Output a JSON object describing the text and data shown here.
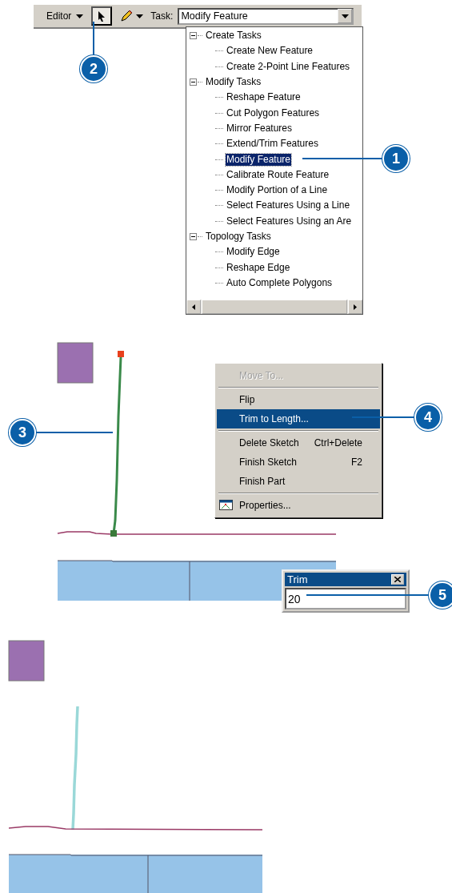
{
  "toolbar": {
    "editor_menu": "Editor",
    "tools": [
      {
        "kind": "pointer",
        "selected": true
      },
      {
        "kind": "pencil",
        "selected": false
      }
    ],
    "task_label": "Task:",
    "task_value": "Modify Feature"
  },
  "task_list": [
    {
      "label": "Create Tasks",
      "expanded": true,
      "children": [
        {
          "label": "Create New Feature",
          "selected": false
        },
        {
          "label": "Create 2-Point Line Features",
          "selected": false
        }
      ]
    },
    {
      "label": "Modify Tasks",
      "expanded": true,
      "children": [
        {
          "label": "Reshape Feature",
          "selected": false
        },
        {
          "label": "Cut Polygon Features",
          "selected": false
        },
        {
          "label": "Mirror Features",
          "selected": false
        },
        {
          "label": "Extend/Trim Features",
          "selected": false
        },
        {
          "label": "Modify Feature",
          "selected": true
        },
        {
          "label": "Calibrate Route Feature",
          "selected": false
        },
        {
          "label": "Modify Portion of a Line",
          "selected": false
        },
        {
          "label": "Select Features Using a Line",
          "selected": false
        },
        {
          "label": "Select Features Using an Are",
          "selected": false
        }
      ]
    },
    {
      "label": "Topology Tasks",
      "expanded": true,
      "children": [
        {
          "label": "Modify Edge",
          "selected": false
        },
        {
          "label": "Reshape Edge",
          "selected": false
        },
        {
          "label": "Auto Complete Polygons",
          "selected": false
        }
      ]
    }
  ],
  "context_menu": [
    {
      "kind": "item",
      "label": "Move To...",
      "disabled": true,
      "selected": false
    },
    {
      "kind": "separator"
    },
    {
      "kind": "item",
      "label": "Flip",
      "disabled": false,
      "selected": false
    },
    {
      "kind": "item",
      "label": "Trim to Length...",
      "disabled": false,
      "selected": true
    },
    {
      "kind": "separator"
    },
    {
      "kind": "item",
      "label": "Delete Sketch",
      "shortcut": "Ctrl+Delete",
      "disabled": false,
      "selected": false
    },
    {
      "kind": "item",
      "label": "Finish Sketch",
      "shortcut": "F2",
      "disabled": false,
      "selected": false
    },
    {
      "kind": "item",
      "label": "Finish Part",
      "disabled": false,
      "selected": false
    },
    {
      "kind": "separator"
    },
    {
      "kind": "icon_item",
      "label": "Properties...",
      "disabled": false,
      "selected": false
    }
  ],
  "trim_dialog": {
    "title": "Trim",
    "value": "20"
  },
  "callouts": [
    {
      "number": "1"
    },
    {
      "number": "2"
    },
    {
      "number": "3"
    },
    {
      "number": "4"
    },
    {
      "number": "5"
    }
  ]
}
